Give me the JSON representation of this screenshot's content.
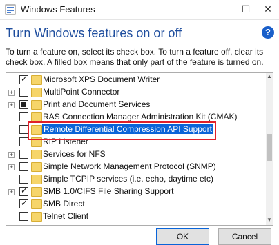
{
  "window": {
    "title": "Windows Features",
    "minimize": "—",
    "maximize": "☐",
    "close": "✕"
  },
  "heading": "Turn Windows features on or off",
  "help": "?",
  "description": "To turn a feature on, select its check box. To turn a feature off, clear its check box. A filled box means that only part of the feature is turned on.",
  "features": [
    {
      "label": "Microsoft XPS Document Writer",
      "expandable": false,
      "state": "checked"
    },
    {
      "label": "MultiPoint Connector",
      "expandable": true,
      "state": "unchecked"
    },
    {
      "label": "Print and Document Services",
      "expandable": true,
      "state": "partial"
    },
    {
      "label": "RAS Connection Manager Administration Kit (CMAK)",
      "expandable": false,
      "state": "unchecked"
    },
    {
      "label": "Remote Differential Compression API Support",
      "expandable": false,
      "state": "unchecked",
      "selected": true
    },
    {
      "label": "RIP Listener",
      "expandable": false,
      "state": "unchecked"
    },
    {
      "label": "Services for NFS",
      "expandable": true,
      "state": "unchecked"
    },
    {
      "label": "Simple Network Management Protocol (SNMP)",
      "expandable": true,
      "state": "unchecked"
    },
    {
      "label": "Simple TCPIP services (i.e. echo, daytime etc)",
      "expandable": false,
      "state": "unchecked"
    },
    {
      "label": "SMB 1.0/CIFS File Sharing Support",
      "expandable": true,
      "state": "checked"
    },
    {
      "label": "SMB Direct",
      "expandable": false,
      "state": "checked"
    },
    {
      "label": "Telnet Client",
      "expandable": false,
      "state": "unchecked"
    }
  ],
  "buttons": {
    "ok": "OK",
    "cancel": "Cancel"
  }
}
